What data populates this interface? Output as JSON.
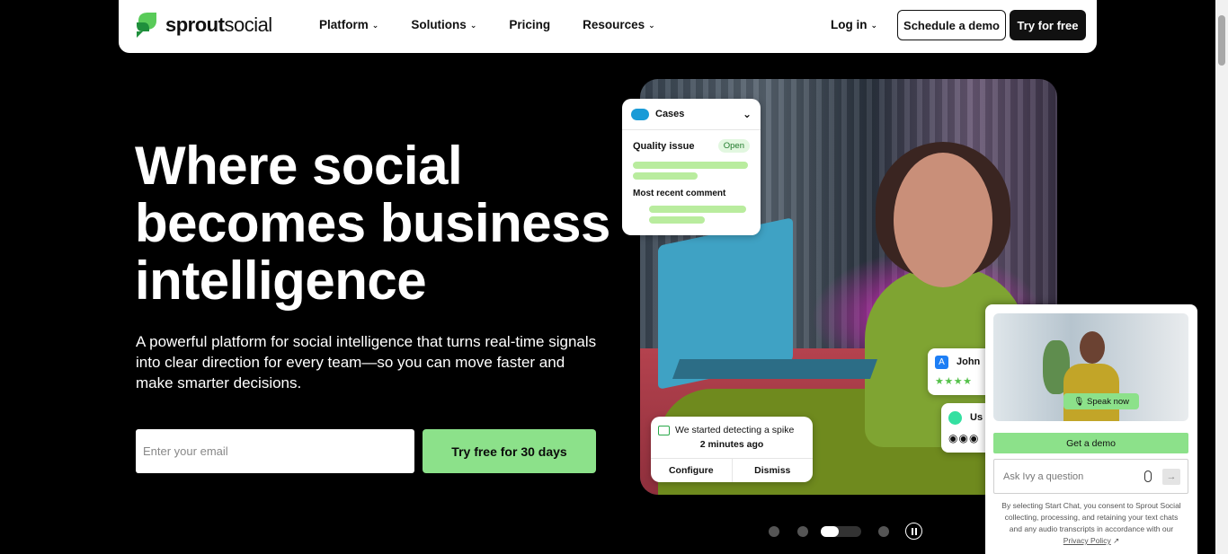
{
  "nav": {
    "logo_bold": "sprout",
    "logo_light": "social",
    "links": [
      {
        "label": "Platform",
        "has_menu": true
      },
      {
        "label": "Solutions",
        "has_menu": true
      },
      {
        "label": "Pricing",
        "has_menu": false
      },
      {
        "label": "Resources",
        "has_menu": true
      }
    ],
    "login": "Log in",
    "schedule_demo": "Schedule a demo",
    "try_free": "Try for free"
  },
  "hero": {
    "headline": "Where social becomes business intelligence",
    "subtext": "A powerful platform for social intelligence that turns real-time signals into clear direction for every team—so you can move faster and make smarter decisions.",
    "email_placeholder": "Enter your email",
    "cta": "Try free for 30 days"
  },
  "cases_card": {
    "title": "Cases",
    "issue": "Quality issue",
    "status": "Open",
    "recent_label": "Most recent comment"
  },
  "spike_card": {
    "message": "We started detecting a spike",
    "time": "2 minutes ago",
    "configure": "Configure",
    "dismiss": "Dismiss"
  },
  "review_cards": {
    "john": "John",
    "second": "Us"
  },
  "carousel": {
    "slides": 4,
    "active_index": 2
  },
  "widget": {
    "speak_now": "Speak now",
    "get_demo": "Get a demo",
    "ask_placeholder": "Ask Ivy a question",
    "consent": "By selecting Start Chat, you consent to Sprout Social collecting, processing, and retaining your text chats and any audio transcripts in accordance with our",
    "privacy_link": "Privacy Policy"
  },
  "colors": {
    "brand_green": "#8ce18a",
    "background": "#000000",
    "nav_bg": "#ffffff"
  }
}
